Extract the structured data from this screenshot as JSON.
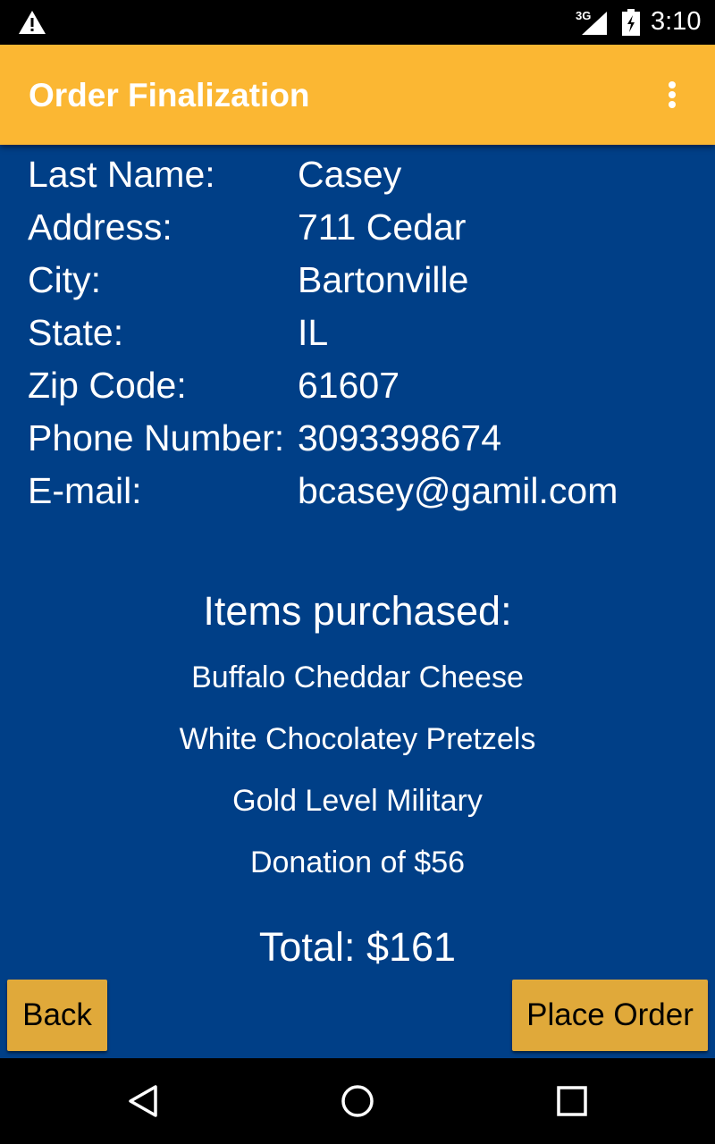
{
  "status_bar": {
    "time": "3:10",
    "network": "3G",
    "icons": [
      "warning-icon",
      "signal-icon",
      "battery-icon"
    ]
  },
  "app_bar": {
    "title": "Order Finalization",
    "menu_icon": "overflow-menu-icon",
    "background_color": "#fbb733"
  },
  "customer": [
    {
      "label": "Last Name:",
      "value": "Casey"
    },
    {
      "label": "Address:",
      "value": "711 Cedar"
    },
    {
      "label": "City:",
      "value": "Bartonville"
    },
    {
      "label": "State:",
      "value": "IL"
    },
    {
      "label": "Zip Code:",
      "value": "61607"
    },
    {
      "label": "Phone Number:",
      "value": "3093398674"
    },
    {
      "label": "E-mail:",
      "value": "bcasey@gamil.com"
    }
  ],
  "items": {
    "heading": "Items purchased:",
    "list": [
      "Buffalo Cheddar Cheese",
      "White Chocolatey Pretzels",
      "Gold Level Military",
      "Donation of $56"
    ]
  },
  "total": "Total: $161",
  "buttons": {
    "back": "Back",
    "place_order": "Place Order"
  },
  "colors": {
    "background": "#003f87",
    "button": "#e0a93a"
  },
  "nav_bar": {
    "icons": [
      "nav-back-icon",
      "nav-home-icon",
      "nav-recents-icon"
    ]
  }
}
